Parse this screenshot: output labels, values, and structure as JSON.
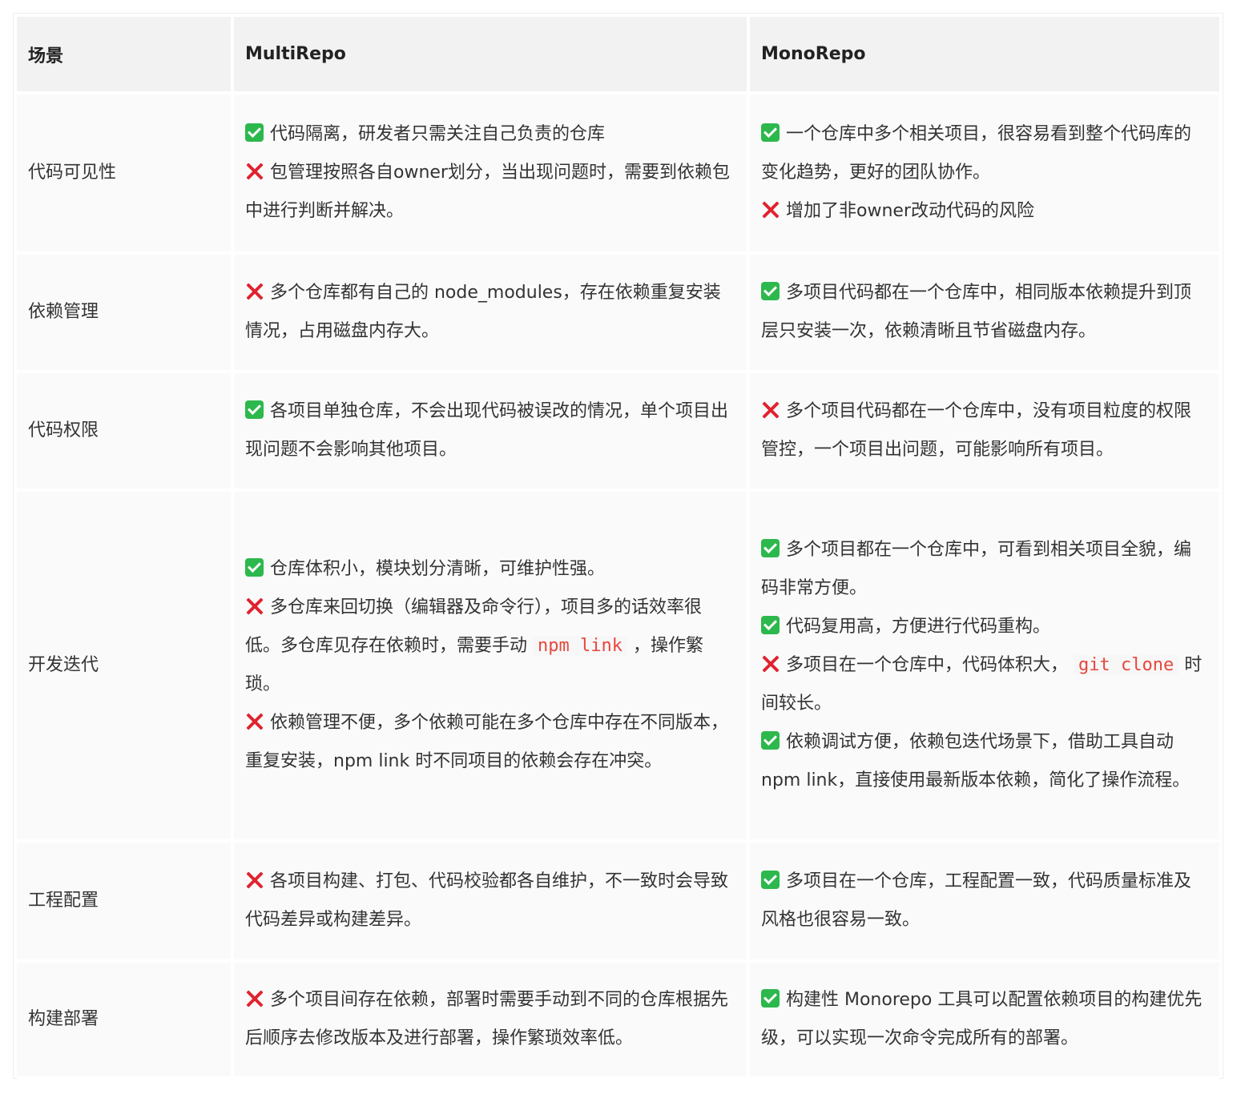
{
  "headers": [
    "场景",
    "MultiRepo",
    "MonoRepo"
  ],
  "rows": [
    {
      "scene": "代码可见性",
      "multi": [
        {
          "icon": "check",
          "parts": [
            {
              "t": "代码隔离，研发者只需关注自己负责的仓库"
            }
          ]
        },
        {
          "icon": "cross",
          "parts": [
            {
              "t": "包管理按照各自owner划分，当出现问题时，需要到依赖包中进行判断并解决。"
            }
          ]
        }
      ],
      "mono": [
        {
          "icon": "check",
          "parts": [
            {
              "t": "一个仓库中多个相关项目，很容易看到整个代码库的变化趋势，更好的团队协作。"
            }
          ]
        },
        {
          "icon": "cross",
          "parts": [
            {
              "t": "增加了非owner改动代码的风险"
            }
          ]
        }
      ]
    },
    {
      "scene": "依赖管理",
      "multi": [
        {
          "icon": "cross",
          "parts": [
            {
              "t": "多个仓库都有自己的 node_modules，存在依赖重复安装情况，占用磁盘内存大。"
            }
          ]
        }
      ],
      "mono": [
        {
          "icon": "check",
          "parts": [
            {
              "t": "多项目代码都在一个仓库中，相同版本依赖提升到顶层只安装一次，依赖清晰且节省磁盘内存。"
            }
          ]
        }
      ]
    },
    {
      "scene": "代码权限",
      "multi": [
        {
          "icon": "check",
          "parts": [
            {
              "t": "各项目单独仓库，不会出现代码被误改的情况，单个项目出现问题不会影响其他项目。"
            }
          ]
        }
      ],
      "mono": [
        {
          "icon": "cross",
          "parts": [
            {
              "t": "多个项目代码都在一个仓库中，没有项目粒度的权限管控，一个项目出问题，可能影响所有项目。"
            }
          ]
        }
      ]
    },
    {
      "scene": "开发迭代",
      "multi": [
        {
          "icon": "check",
          "parts": [
            {
              "t": "仓库体积小，模块划分清晰，可维护性强。"
            }
          ]
        },
        {
          "icon": "cross",
          "parts": [
            {
              "t": "多仓库来回切换（编辑器及命令行），项目多的话效率很低。多仓库见存在依赖时，需要手动 "
            },
            {
              "t": "npm link",
              "code": true
            },
            {
              "t": " ，操作繁琐。"
            }
          ]
        },
        {
          "icon": "cross",
          "parts": [
            {
              "t": "依赖管理不便，多个依赖可能在多个仓库中存在不同版本，重复安装，npm link 时不同项目的依赖会存在冲突。"
            }
          ]
        }
      ],
      "mono": [
        {
          "icon": "check",
          "parts": [
            {
              "t": "多个项目都在一个仓库中，可看到相关项目全貌，编码非常方便。"
            }
          ]
        },
        {
          "icon": "check",
          "parts": [
            {
              "t": "代码复用高，方便进行代码重构。"
            }
          ]
        },
        {
          "icon": "cross",
          "parts": [
            {
              "t": "多项目在一个仓库中，代码体积大， "
            },
            {
              "t": "git clone",
              "code": true
            },
            {
              "t": " 时间较长。"
            }
          ]
        },
        {
          "icon": "check",
          "parts": [
            {
              "t": "依赖调试方便，依赖包迭代场景下，借助工具自动 npm link，直接使用最新版本依赖，简化了操作流程。"
            }
          ]
        }
      ]
    },
    {
      "scene": "工程配置",
      "multi": [
        {
          "icon": "cross",
          "parts": [
            {
              "t": "各项目构建、打包、代码校验都各自维护，不一致时会导致代码差异或构建差异。"
            }
          ]
        }
      ],
      "mono": [
        {
          "icon": "check",
          "parts": [
            {
              "t": "多项目在一个仓库，工程配置一致，代码质量标准及风格也很容易一致。"
            }
          ]
        }
      ]
    },
    {
      "scene": "构建部署",
      "multi": [
        {
          "icon": "cross",
          "parts": [
            {
              "t": "多个项目间存在依赖，部署时需要手动到不同的仓库根据先后顺序去修改版本及进行部署，操作繁琐效率低。"
            }
          ]
        }
      ],
      "mono": [
        {
          "icon": "check",
          "parts": [
            {
              "t": "构建性 Monorepo 工具可以配置依赖项目的构建优先级，可以实现一次命令完成所有的部署。"
            }
          ]
        }
      ]
    }
  ]
}
